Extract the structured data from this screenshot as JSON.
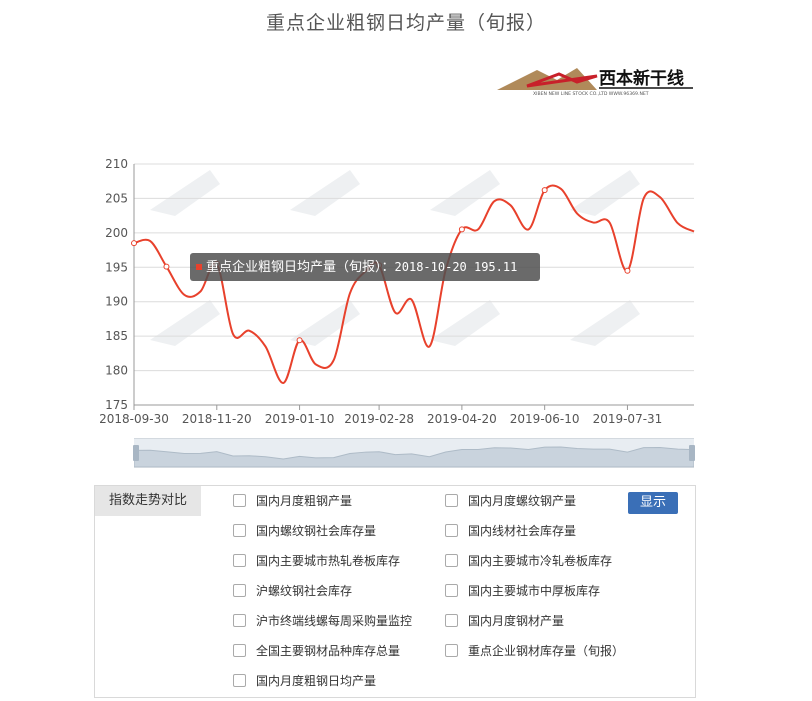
{
  "title": "重点企业粗钢日均产量（旬报）",
  "logo": {
    "text": "西本新干线",
    "subtext": "XIBEN NEW LINE STOCK CO.,LTD   WWW.96369.NET"
  },
  "chart_data": {
    "type": "line",
    "series": [
      {
        "name": "重点企业粗钢日均产量（旬报）",
        "color": "#e8412c",
        "points": [
          [
            "2018-09-30",
            198.5
          ],
          [
            "2018-10-10",
            198.8
          ],
          [
            "2018-10-20",
            195.1
          ],
          [
            "2018-10-31",
            191.0
          ],
          [
            "2018-11-10",
            191.5
          ],
          [
            "2018-11-20",
            195.5
          ],
          [
            "2018-11-30",
            185.3
          ],
          [
            "2018-12-10",
            185.8
          ],
          [
            "2018-12-20",
            183.5
          ],
          [
            "2018-12-31",
            178.2
          ],
          [
            "2019-01-10",
            184.4
          ],
          [
            "2019-01-20",
            180.9
          ],
          [
            "2019-01-31",
            181.5
          ],
          [
            "2019-02-10",
            191.2
          ],
          [
            "2019-02-20",
            194.5
          ],
          [
            "2019-02-28",
            195.3
          ],
          [
            "2019-03-10",
            188.4
          ],
          [
            "2019-03-20",
            190.3
          ],
          [
            "2019-03-31",
            183.5
          ],
          [
            "2019-04-10",
            194.6
          ],
          [
            "2019-04-20",
            200.5
          ],
          [
            "2019-04-30",
            200.5
          ],
          [
            "2019-05-10",
            204.6
          ],
          [
            "2019-05-20",
            204.0
          ],
          [
            "2019-05-31",
            200.5
          ],
          [
            "2019-06-10",
            206.2
          ],
          [
            "2019-06-20",
            206.4
          ],
          [
            "2019-06-30",
            202.8
          ],
          [
            "2019-07-10",
            201.5
          ],
          [
            "2019-07-20",
            201.5
          ],
          [
            "2019-07-31",
            194.5
          ],
          [
            "2019-08-10",
            205.0
          ],
          [
            "2019-08-20",
            205.2
          ],
          [
            "2019-08-31",
            201.4
          ],
          [
            "2019-09-10",
            200.2
          ]
        ]
      }
    ],
    "x_ticks": [
      "2018-09-30",
      "2018-11-20",
      "2019-01-10",
      "2019-02-28",
      "2019-04-20",
      "2019-06-10",
      "2019-07-31"
    ],
    "y_ticks": [
      175,
      180,
      185,
      190,
      195,
      200,
      205,
      210
    ],
    "ylim": [
      175,
      210
    ],
    "grid": true
  },
  "tooltip": {
    "series": "重点企业粗钢日均产量（旬报）：",
    "value": "2018-10-20  195.11"
  },
  "compare_panel": {
    "header": "指数走势对比",
    "show_button": "显示",
    "options": [
      "国内月度粗钢产量",
      "国内月度螺纹钢产量",
      "国内螺纹钢社会库存量",
      "国内线材社会库存量",
      "国内主要城市热轧卷板库存",
      "国内主要城市冷轧卷板库存",
      "沪螺纹钢社会库存",
      "国内主要城市中厚板库存",
      "沪市终端线螺每周采购量监控",
      "国内月度钢材产量",
      "全国主要钢材品种库存总量",
      "重点企业钢材库存量（旬报）",
      "国内月度粗钢日均产量"
    ]
  }
}
